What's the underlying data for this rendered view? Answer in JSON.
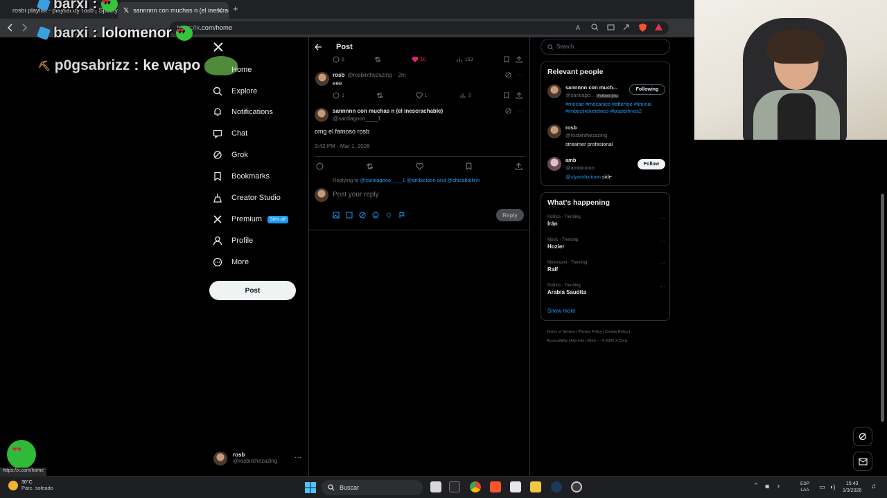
{
  "browser": {
    "tabs": [
      {
        "title": "rosbi playlist - playlist by rosb | Spotify"
      },
      {
        "title": "sannnnn con muchas n (el inescrachable)"
      }
    ],
    "url_scheme": "https://x",
    "url_host": ".com/home",
    "status_url": "https://x.com/home"
  },
  "chat_overlay": [
    {
      "user": "barxi",
      "message": ""
    },
    {
      "user": "barxi",
      "message": "lolomenor"
    },
    {
      "user": "p0gsabrizz",
      "message": "ke wapo"
    }
  ],
  "nav": {
    "items": [
      {
        "label": "Home",
        "icon": "home-icon"
      },
      {
        "label": "Explore",
        "icon": "search-icon"
      },
      {
        "label": "Notifications",
        "icon": "bell-icon"
      },
      {
        "label": "Chat",
        "icon": "chat-icon"
      },
      {
        "label": "Grok",
        "icon": "grok-icon"
      },
      {
        "label": "Bookmarks",
        "icon": "bookmark-icon"
      },
      {
        "label": "Creator Studio",
        "icon": "creator-studio-icon"
      },
      {
        "label": "Premium",
        "icon": "x-icon"
      },
      {
        "label": "Profile",
        "icon": "person-icon"
      },
      {
        "label": "More",
        "icon": "more-circle-icon"
      }
    ],
    "premium_badge": "50% off",
    "post_button": "Post",
    "account": {
      "name": "rosb",
      "handle": "@rosbinthezazing",
      "more": "···"
    }
  },
  "post_view": {
    "header": "Post",
    "first_actions": {
      "replies": "8",
      "likes": "10",
      "views": "153"
    },
    "reply": {
      "name": "rosb",
      "handle": "@rosbinthezazing",
      "time": "· 2m",
      "text": "eee",
      "actions": {
        "replies": "1",
        "likes": "1",
        "views": "3"
      }
    },
    "main": {
      "name": "sannnnn con muchas n (el inescrachable)",
      "handle": "@santiagooo____1",
      "text": "omg el famoso rosb",
      "timestamp": "3:42 PM · Mar 1, 2026"
    },
    "replying_to_prefix": "Replying to",
    "replying_to_links": "@santiagooo____1 @ambicioon and @chicaballinn",
    "reply_placeholder": "Post your reply",
    "reply_button": "Reply"
  },
  "sidebar": {
    "search_placeholder": "Search",
    "relevant_title": "Relevant people",
    "people": [
      {
        "name": "sannnnn con much...",
        "handle": "@santiago...",
        "follows_you": "Follows you",
        "bio_hashtags": "#mecae #mecanico #afterfoe #liminal #imbecilreketeloco #lospibihnos2",
        "bio_text": "",
        "button": "Following"
      },
      {
        "name": "rosb",
        "handle": "@rosbinthezazing",
        "follows_you": "",
        "bio_hashtags": "",
        "bio_text": "streamer profesional",
        "button": ""
      },
      {
        "name": "amb",
        "handle": "@ambicioon",
        "follows_you": "",
        "bio_hashtags": "@slyambicioon",
        "bio_text": " side",
        "button": "Follow"
      }
    ],
    "happening_title": "What’s happening",
    "trends": [
      {
        "meta": "Politics · Trending",
        "topic": "Irán"
      },
      {
        "meta": "Music · Trending",
        "topic": "Hozier"
      },
      {
        "meta": "Motorsport · Trending",
        "topic": "Ralf"
      },
      {
        "meta": "Politics · Trending",
        "topic": "Arabia Saudita"
      }
    ],
    "show_more": "Show more",
    "footer_line1": "Terms of Service  |  Privacy Policy  |  Cookie Policy  |",
    "footer_line2": "Accessibility  |  Ads info  |  More ···  © 2026 X Corp."
  },
  "taskbar": {
    "weather_temp": "30°C",
    "weather_cond": "Parc. soleado",
    "search_label": "Buscar",
    "lang_1": "ESP",
    "lang_2": "LAA",
    "time": "15:43",
    "date": "1/3/2026"
  },
  "colors": {
    "accent": "#1d9bf0",
    "like": "#f91880",
    "background": "#000000"
  }
}
